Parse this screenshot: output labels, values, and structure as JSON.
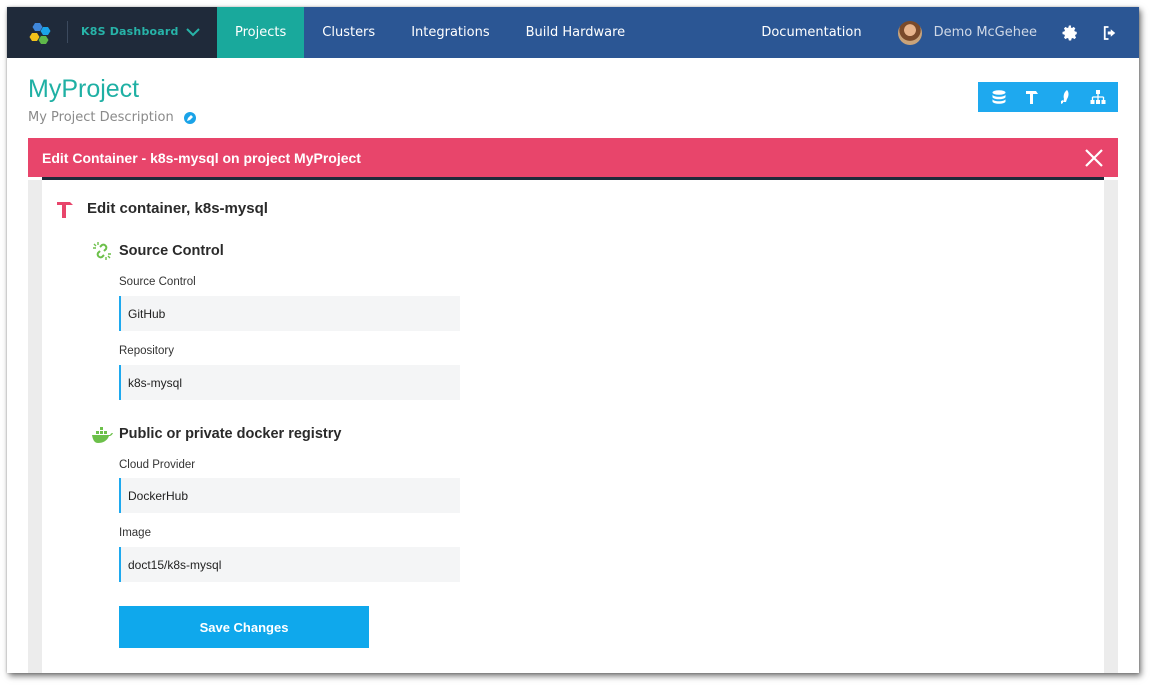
{
  "nav": {
    "brand": "K8S Dashboard",
    "items": [
      {
        "label": "Projects",
        "active": true
      },
      {
        "label": "Clusters",
        "active": false
      },
      {
        "label": "Integrations",
        "active": false
      },
      {
        "label": "Build Hardware",
        "active": false
      }
    ],
    "documentation": "Documentation",
    "user_name": "Demo McGehee"
  },
  "project": {
    "title": "MyProject",
    "description": "My Project Description"
  },
  "toolbar_icons": [
    "database-icon",
    "hammer-icon",
    "rocket-icon",
    "sitemap-icon"
  ],
  "banner": {
    "title": "Edit Container - k8s-mysql on project MyProject"
  },
  "form": {
    "heading": "Edit container, k8s-mysql",
    "source_section": {
      "title": "Source Control",
      "source_label": "Source Control",
      "source_value": "GitHub",
      "repo_label": "Repository",
      "repo_value": "k8s-mysql"
    },
    "registry_section": {
      "title": "Public or private docker registry",
      "provider_label": "Cloud Provider",
      "provider_value": "DockerHub",
      "image_label": "Image",
      "image_value": "doct15/k8s-mysql"
    },
    "save_label": "Save Changes"
  },
  "colors": {
    "nav_bg": "#2b5694",
    "brand_bg": "#1f2a3a",
    "accent_teal": "#19a99c",
    "banner_red": "#e8456b",
    "button_blue": "#0fa8ec"
  }
}
